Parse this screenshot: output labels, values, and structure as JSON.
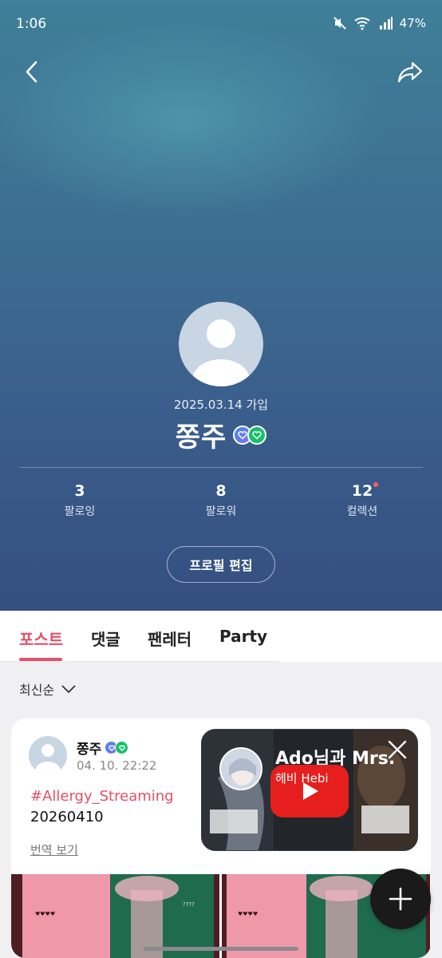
{
  "status_bar": {
    "time": "1:06",
    "battery": "47%",
    "wifi_label": "6"
  },
  "profile": {
    "joined": "2025.03.14 가입",
    "name": "쫑주",
    "stats": [
      {
        "value": "3",
        "label": "팔로잉"
      },
      {
        "value": "8",
        "label": "팔로워"
      },
      {
        "value": "12",
        "label": "컬렉션"
      }
    ],
    "edit_button": "프로필 편집"
  },
  "tabs": [
    "포스트",
    "댓글",
    "팬레터",
    "Party"
  ],
  "sort": {
    "label": "최신순"
  },
  "post": {
    "author": "쫑주",
    "date": "04. 10. 22:22",
    "hashtag": "#Allergy_Streaming",
    "body": "20260410",
    "translate": "번역 보기"
  },
  "mini_player": {
    "title": "Ado님과 Mrs.",
    "channel": "헤비 Hebi"
  },
  "colors": {
    "accent": "#e2506a",
    "badge_green": "#17c067",
    "youtube_red": "#e61e1e"
  }
}
